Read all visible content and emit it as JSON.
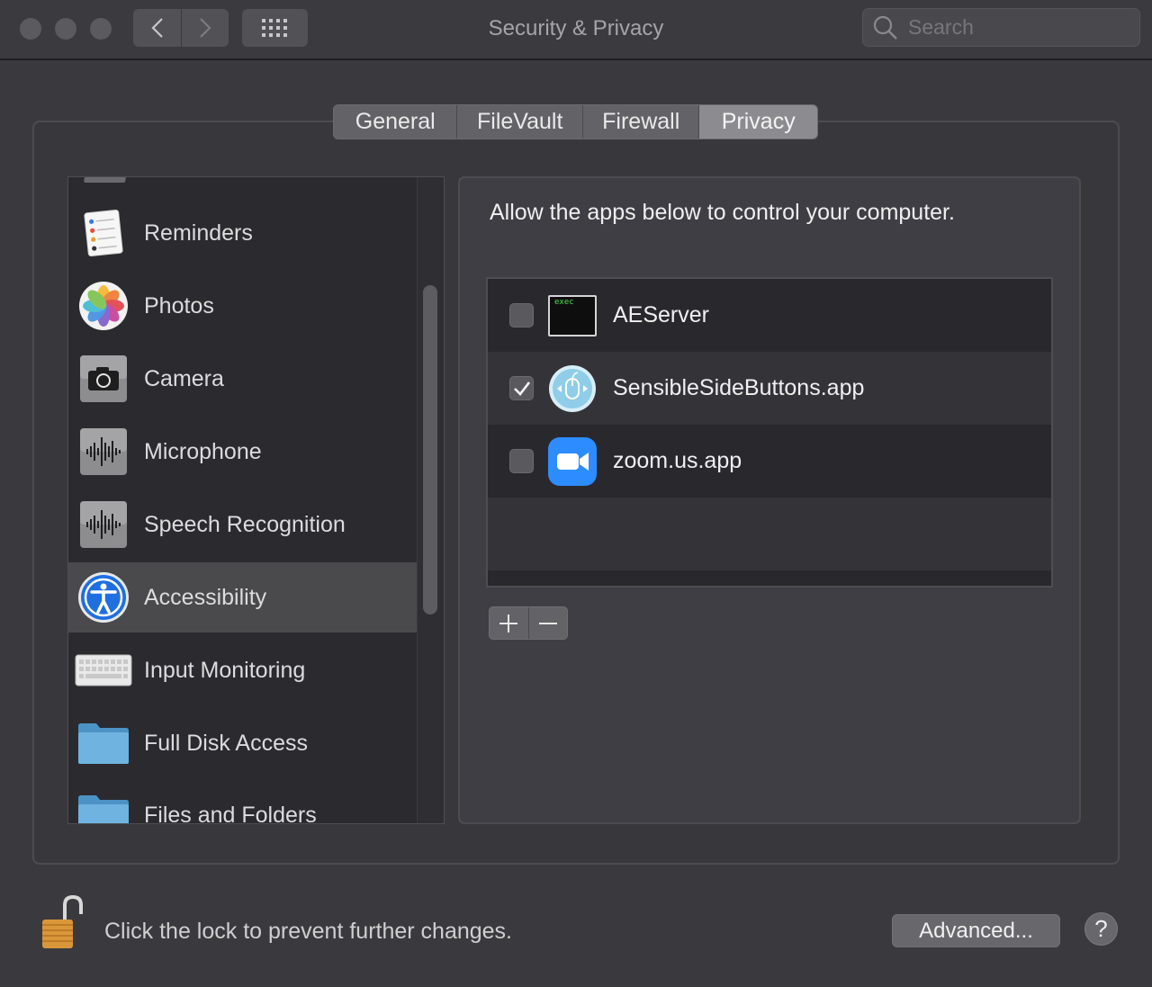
{
  "window": {
    "title": "Security & Privacy",
    "search_placeholder": "Search"
  },
  "tabs": [
    {
      "label": "General",
      "selected": false
    },
    {
      "label": "FileVault",
      "selected": false
    },
    {
      "label": "Firewall",
      "selected": false
    },
    {
      "label": "Privacy",
      "selected": true
    }
  ],
  "sidebar": {
    "items": [
      {
        "label": "Reminders",
        "icon": "reminders-icon"
      },
      {
        "label": "Photos",
        "icon": "photos-icon"
      },
      {
        "label": "Camera",
        "icon": "camera-icon"
      },
      {
        "label": "Microphone",
        "icon": "microphone-icon"
      },
      {
        "label": "Speech Recognition",
        "icon": "speech-recognition-icon"
      },
      {
        "label": "Accessibility",
        "icon": "accessibility-icon",
        "selected": true
      },
      {
        "label": "Input Monitoring",
        "icon": "keyboard-icon"
      },
      {
        "label": "Full Disk Access",
        "icon": "folder-icon"
      },
      {
        "label": "Files and Folders",
        "icon": "folder-icon"
      }
    ]
  },
  "pane": {
    "title": "Allow the apps below to control your computer.",
    "apps": [
      {
        "label": "AEServer",
        "checked": false,
        "icon": "terminal-exec-icon",
        "icon_text": "exec"
      },
      {
        "label": "SensibleSideButtons.app",
        "checked": true,
        "icon": "mouse-app-icon"
      },
      {
        "label": "zoom.us.app",
        "checked": false,
        "icon": "zoom-camera-icon"
      }
    ]
  },
  "footer": {
    "lock_text": "Click the lock to prevent further changes.",
    "advanced_label": "Advanced...",
    "help_label": "?"
  },
  "colors": {
    "zoom_blue": "#2d8cff",
    "accessibility_blue": "#1f6fe0",
    "folder_blue": "#5aa7d6"
  }
}
